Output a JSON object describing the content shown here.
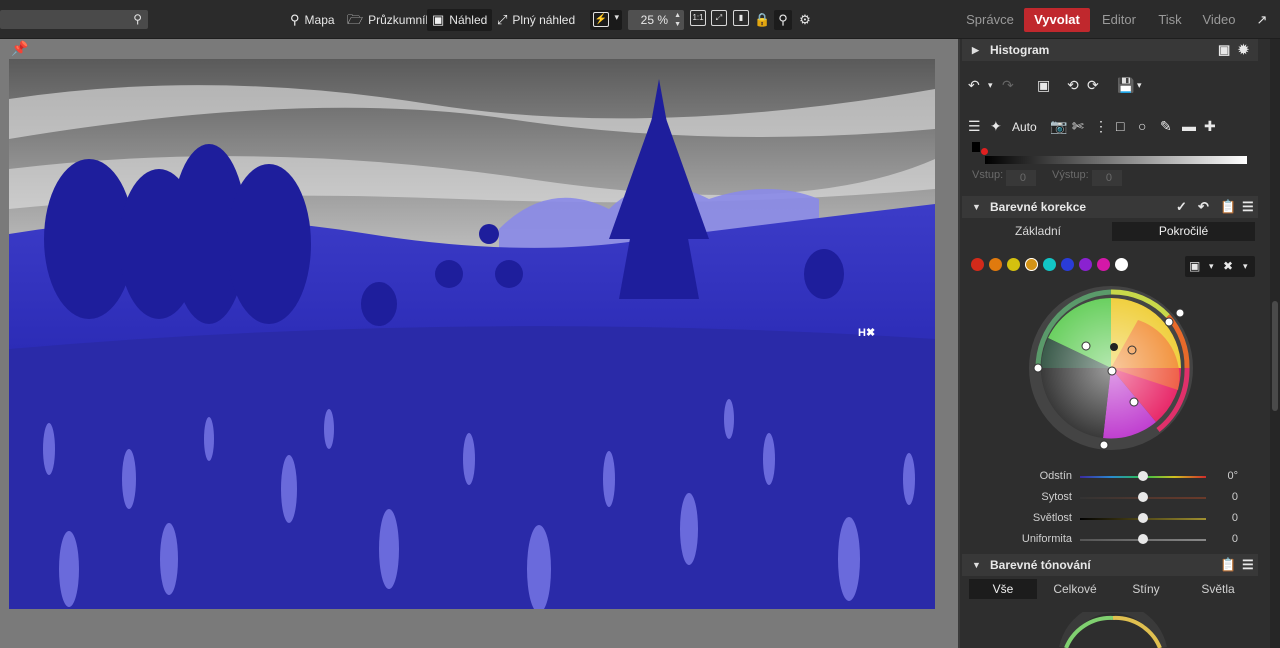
{
  "top": {
    "search_icon": "search-icon",
    "nav": [
      {
        "label": "Mapa",
        "icon": "map-pin-icon"
      },
      {
        "label": "Průzkumník",
        "icon": "folder-icon"
      },
      {
        "label": "Náhled",
        "icon": "image-icon"
      },
      {
        "label": "Plný náhled",
        "icon": "fullscreen-icon"
      }
    ],
    "flash_dropdown": "▾",
    "zoom": "25 %",
    "zoom_1to1": "1:1",
    "modules": [
      "Správce",
      "Vyvolat",
      "Editor",
      "Tisk",
      "Video"
    ],
    "active_module": "Vyvolat",
    "accent": "#c0282d"
  },
  "panel": {
    "histogram_label": "Histogram",
    "tools_auto": "Auto",
    "levels": {
      "input_label": "Vstup:",
      "input_value": "0",
      "output_label": "Výstup:",
      "output_value": "0"
    },
    "color_correction": {
      "title": "Barevné korekce",
      "tabs": [
        "Základní",
        "Pokročilé"
      ],
      "active_tab": "Pokročilé",
      "swatches": [
        "#d32a1a",
        "#e07a0e",
        "#d4c10f",
        "#d39316",
        "#12c6c6",
        "#2a3cd8",
        "#8a22d0",
        "#d418a8",
        "#ffffff"
      ],
      "sliders": [
        {
          "label": "Odstín",
          "value": "0°",
          "gradient": "linear-gradient(to right,#3b2aa0,#2a8ad0,#2ac04a,#d0c020,#d02a2a)"
        },
        {
          "label": "Sytost",
          "value": "0",
          "gradient": "linear-gradient(to right,#333,#6a3a2a)"
        },
        {
          "label": "Světlost",
          "value": "0",
          "gradient": "linear-gradient(to right,#000,#a09030)"
        },
        {
          "label": "Uniformita",
          "value": "0",
          "gradient": "linear-gradient(to right,#555,#888)"
        }
      ]
    },
    "toning": {
      "title": "Barevné tónování",
      "tabs": [
        "Vše",
        "Celkové",
        "Stíny",
        "Světla"
      ],
      "active_tab": "Vše"
    }
  }
}
